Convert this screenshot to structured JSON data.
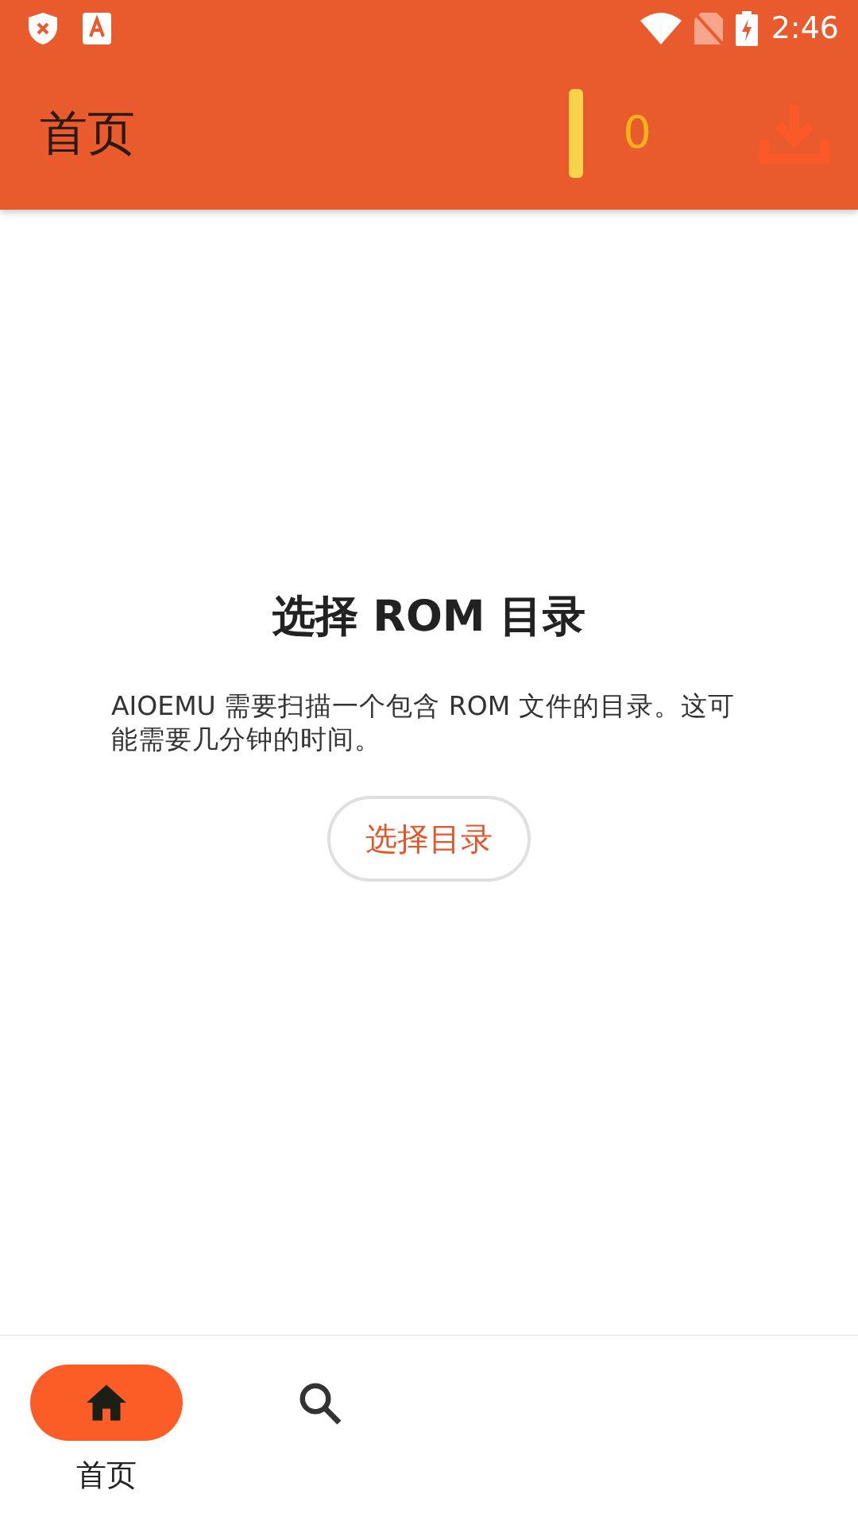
{
  "status_bar": {
    "time": "2:46"
  },
  "app_bar": {
    "title": "首页",
    "coin_count": "0"
  },
  "empty_state": {
    "title": "选择 ROM 目录",
    "message": "AIOEMU 需要扫描一个包含 ROM 文件的目录。这可能需要几分钟的时间。",
    "button": "选择目录"
  },
  "bottom_nav": [
    {
      "kind": "home",
      "label": "首页",
      "selected": true
    },
    {
      "kind": "search",
      "selected": false
    }
  ]
}
